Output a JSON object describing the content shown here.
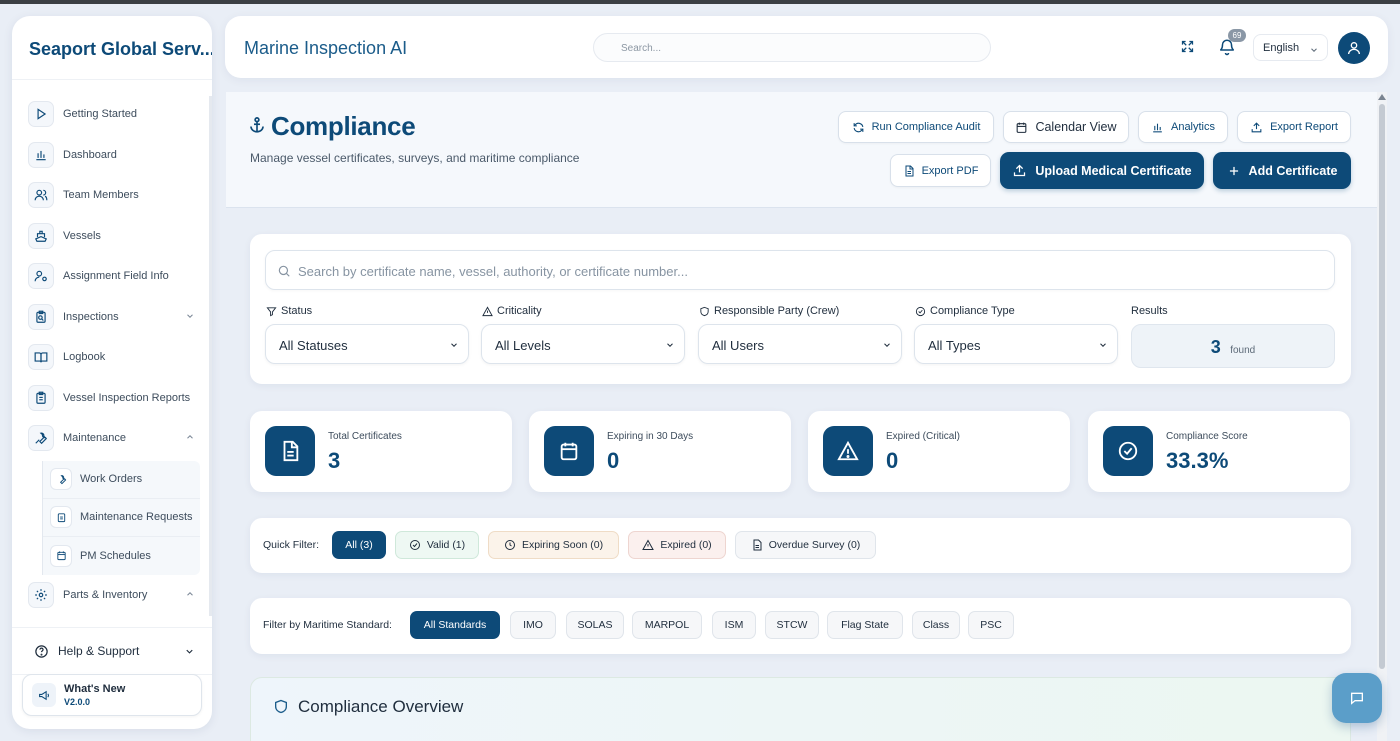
{
  "sidebar": {
    "brand": "Seaport Global Serv...",
    "items": [
      {
        "label": "Getting Started"
      },
      {
        "label": "Dashboard"
      },
      {
        "label": "Team Members"
      },
      {
        "label": "Vessels"
      },
      {
        "label": "Assignment Field Info"
      },
      {
        "label": "Inspections"
      },
      {
        "label": "Logbook"
      },
      {
        "label": "Vessel Inspection Reports"
      },
      {
        "label": "Maintenance"
      },
      {
        "label": "Parts & Inventory"
      }
    ],
    "maintenance_sub": [
      {
        "label": "Work Orders"
      },
      {
        "label": "Maintenance Requests"
      },
      {
        "label": "PM Schedules"
      }
    ],
    "help": "Help & Support",
    "whats_new": {
      "title": "What's New",
      "version": "V2.0.0"
    }
  },
  "topbar": {
    "app_title": "Marine Inspection AI",
    "search_placeholder": "Search...",
    "notification_count": "69",
    "language": "English"
  },
  "page": {
    "title": "Compliance",
    "subtitle": "Manage vessel certificates, surveys, and maritime compliance",
    "buttons": {
      "run_audit": "Run Compliance Audit",
      "calendar": "Calendar View",
      "analytics": "Analytics",
      "export_report": "Export Report",
      "export_pdf": "Export PDF",
      "upload_medical": "Upload Medical Certificate",
      "add_certificate": "Add Certificate"
    }
  },
  "filters": {
    "search_placeholder": "Search by certificate name, vessel, authority, or certificate number...",
    "status": {
      "label": "Status",
      "value": "All Statuses"
    },
    "criticality": {
      "label": "Criticality",
      "value": "All Levels"
    },
    "responsible": {
      "label": "Responsible Party (Crew)",
      "value": "All Users"
    },
    "compliance_type": {
      "label": "Compliance Type",
      "value": "All Types"
    },
    "results": {
      "label": "Results",
      "count": "3",
      "word": "found"
    }
  },
  "stats": [
    {
      "label": "Total Certificates",
      "value": "3"
    },
    {
      "label": "Expiring in 30 Days",
      "value": "0"
    },
    {
      "label": "Expired (Critical)",
      "value": "0"
    },
    {
      "label": "Compliance Score",
      "value": "33.3%"
    }
  ],
  "quick_filter": {
    "label": "Quick Filter:",
    "pills": [
      "All (3)",
      "Valid (1)",
      "Expiring Soon (0)",
      "Expired (0)",
      "Overdue Survey (0)"
    ]
  },
  "standards": {
    "label": "Filter by Maritime Standard:",
    "pills": [
      "All Standards",
      "IMO",
      "SOLAS",
      "MARPOL",
      "ISM",
      "STCW",
      "Flag State",
      "Class",
      "PSC"
    ]
  },
  "overview": {
    "title": "Compliance Overview"
  },
  "colors": {
    "primary": "#0d4a78",
    "background": "#e9eef6",
    "fab": "#5b9ec9"
  }
}
